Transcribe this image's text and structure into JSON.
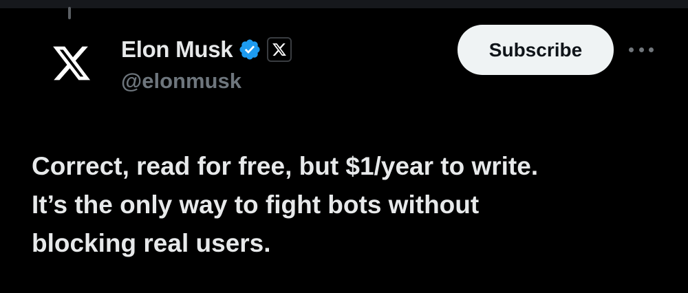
{
  "author": {
    "display_name": "Elon Musk",
    "handle": "@elonmusk",
    "verified": true,
    "avatar_icon": "x-logo-icon",
    "affiliate_badge_icon": "x-logo-icon"
  },
  "actions": {
    "subscribe_label": "Subscribe",
    "more_icon": "more-horizontal-icon"
  },
  "tweet": {
    "lines": [
      "Correct, read for free, but $1/year to write.",
      "It’s the only way to fight bots without",
      "blocking real users."
    ]
  },
  "colors": {
    "background": "#000000",
    "text_primary": "#e7e9ea",
    "text_secondary": "#6e767d",
    "verified_blue": "#1d9bf0",
    "button_bg": "#eff3f4",
    "button_text": "#0f1419"
  }
}
